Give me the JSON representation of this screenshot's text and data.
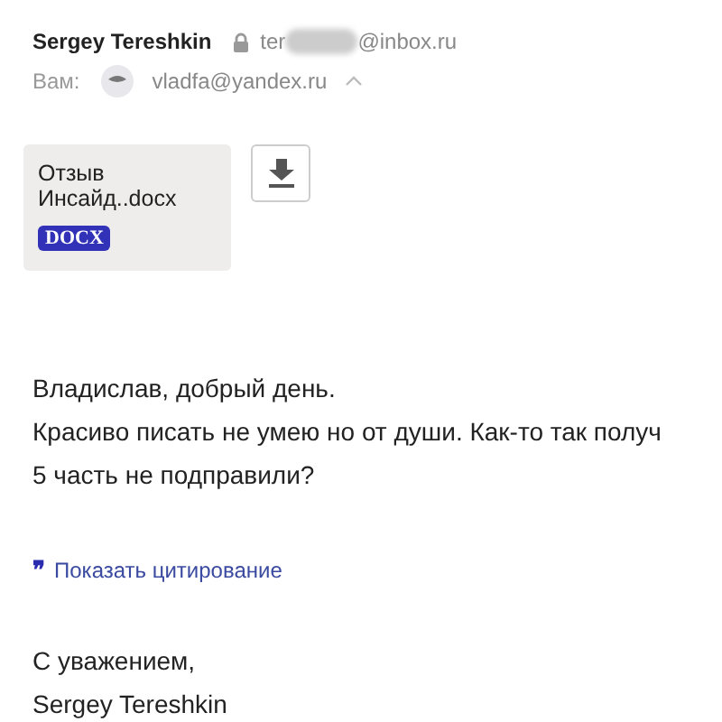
{
  "header": {
    "sender_name": "Sergey Tereshkin",
    "sender_email_start": "ter",
    "sender_email_end": "@inbox.ru",
    "to_label": "Вам:",
    "recipient_email": "vladfa@yandex.ru",
    "expanded": true
  },
  "attachment": {
    "name_line1": "Отзыв",
    "name_line2": "Инсайд..docx",
    "type": "DOCX"
  },
  "body": [
    "Владислав, добрый день.",
    "Красиво писать не умею но от души. Как-то так получ",
    "5 часть не подправили?"
  ],
  "quote_link": {
    "icon": "❞",
    "label": "Показать цитирование"
  },
  "signature": [
    "С уважением,",
    "Sergey Tereshkin"
  ]
}
